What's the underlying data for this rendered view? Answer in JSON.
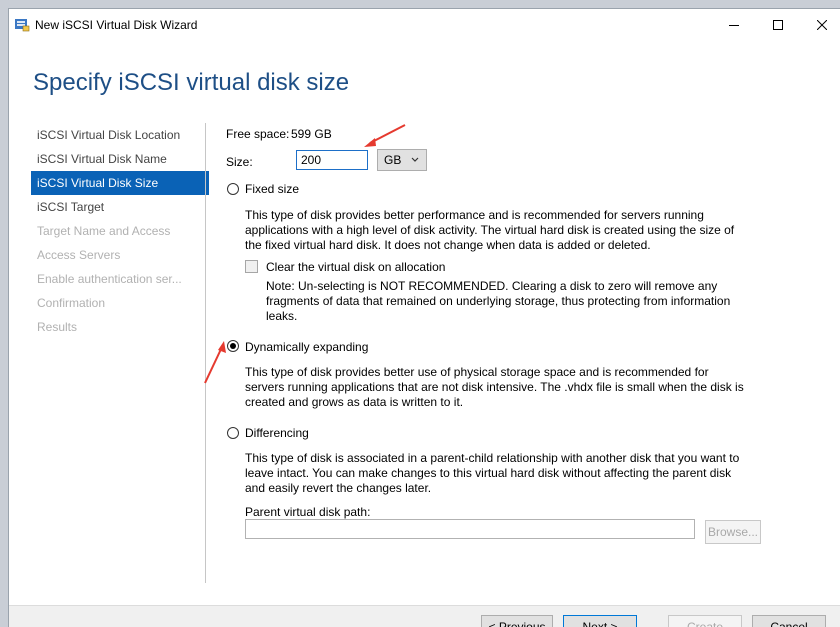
{
  "window": {
    "title": "New iSCSI Virtual Disk Wizard"
  },
  "page": {
    "heading": "Specify iSCSI virtual disk size"
  },
  "nav": [
    {
      "label": "iSCSI Virtual Disk Location",
      "state": "normal"
    },
    {
      "label": "iSCSI Virtual Disk Name",
      "state": "normal"
    },
    {
      "label": "iSCSI Virtual Disk Size",
      "state": "active"
    },
    {
      "label": "iSCSI Target",
      "state": "normal"
    },
    {
      "label": "Target Name and Access",
      "state": "disabled"
    },
    {
      "label": "Access Servers",
      "state": "disabled"
    },
    {
      "label": "Enable authentication ser...",
      "state": "disabled"
    },
    {
      "label": "Confirmation",
      "state": "disabled"
    },
    {
      "label": "Results",
      "state": "disabled"
    }
  ],
  "size": {
    "free_space_label": "Free space:",
    "free_space_value": "599 GB",
    "size_label": "Size:",
    "size_value": "200",
    "unit": "GB"
  },
  "options": {
    "fixed": {
      "label": "Fixed size",
      "selected": false,
      "description": "This type of disk provides better performance and is recommended for servers running applications with a high level of disk activity. The virtual hard disk is created using the size of the fixed virtual hard disk. It does not change when data is added or deleted.",
      "clear_label": "Clear the virtual disk on allocation",
      "clear_note": "Note: Un-selecting is NOT RECOMMENDED. Clearing a disk to zero will remove any fragments of data that remained on underlying storage, thus protecting from information leaks."
    },
    "dynamic": {
      "label": "Dynamically expanding",
      "selected": true,
      "description": "This type of disk provides better use of physical storage space and is recommended for servers running applications that are not disk intensive. The .vhdx file is small when the disk is created and grows as data is written to it."
    },
    "differencing": {
      "label": "Differencing",
      "selected": false,
      "description": "This type of disk is associated in a parent-child relationship with another disk that you want to leave intact. You can make changes to this virtual hard disk without affecting the parent disk and easily revert the changes later.",
      "parent_path_label": "Parent virtual disk path:",
      "browse_label": "Browse..."
    }
  },
  "footer": {
    "previous_label": "< Previous",
    "next_label": "Next >",
    "create_label": "Create",
    "cancel_label": "Cancel"
  },
  "colors": {
    "accent": "#0a62b6",
    "heading": "#1e4f86",
    "annotation_arrow": "#e53a2f"
  }
}
